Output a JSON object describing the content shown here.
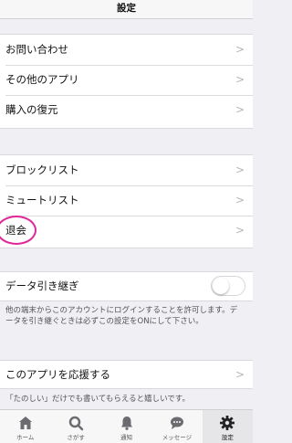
{
  "header": {
    "title": "設定"
  },
  "group1": {
    "items": [
      {
        "label": "お問い合わせ"
      },
      {
        "label": "その他のアプリ"
      },
      {
        "label": "購入の復元"
      }
    ]
  },
  "group2": {
    "items": [
      {
        "label": "ブロックリスト"
      },
      {
        "label": "ミュートリスト"
      },
      {
        "label": "退会"
      }
    ]
  },
  "transfer": {
    "label": "データ引き継ぎ",
    "enabled": false,
    "note": "他の端末からこのアカウントにログインすることを許可します。データを引き継ぐときは必ずこの設定をONにして下さい。"
  },
  "support": {
    "label": "このアプリを応援する",
    "note": "「たのしい」だけでも書いてもらえると嬉しいです。"
  },
  "tabbar": {
    "tabs": [
      {
        "label": "ホーム",
        "icon": "home-icon"
      },
      {
        "label": "さがす",
        "icon": "search-icon"
      },
      {
        "label": "通知",
        "icon": "bell-icon"
      },
      {
        "label": "メッセージ",
        "icon": "message-icon"
      },
      {
        "label": "設定",
        "icon": "gear-icon",
        "active": true
      }
    ]
  },
  "colors": {
    "highlight": "#e0279a",
    "background": "#efeff4"
  }
}
